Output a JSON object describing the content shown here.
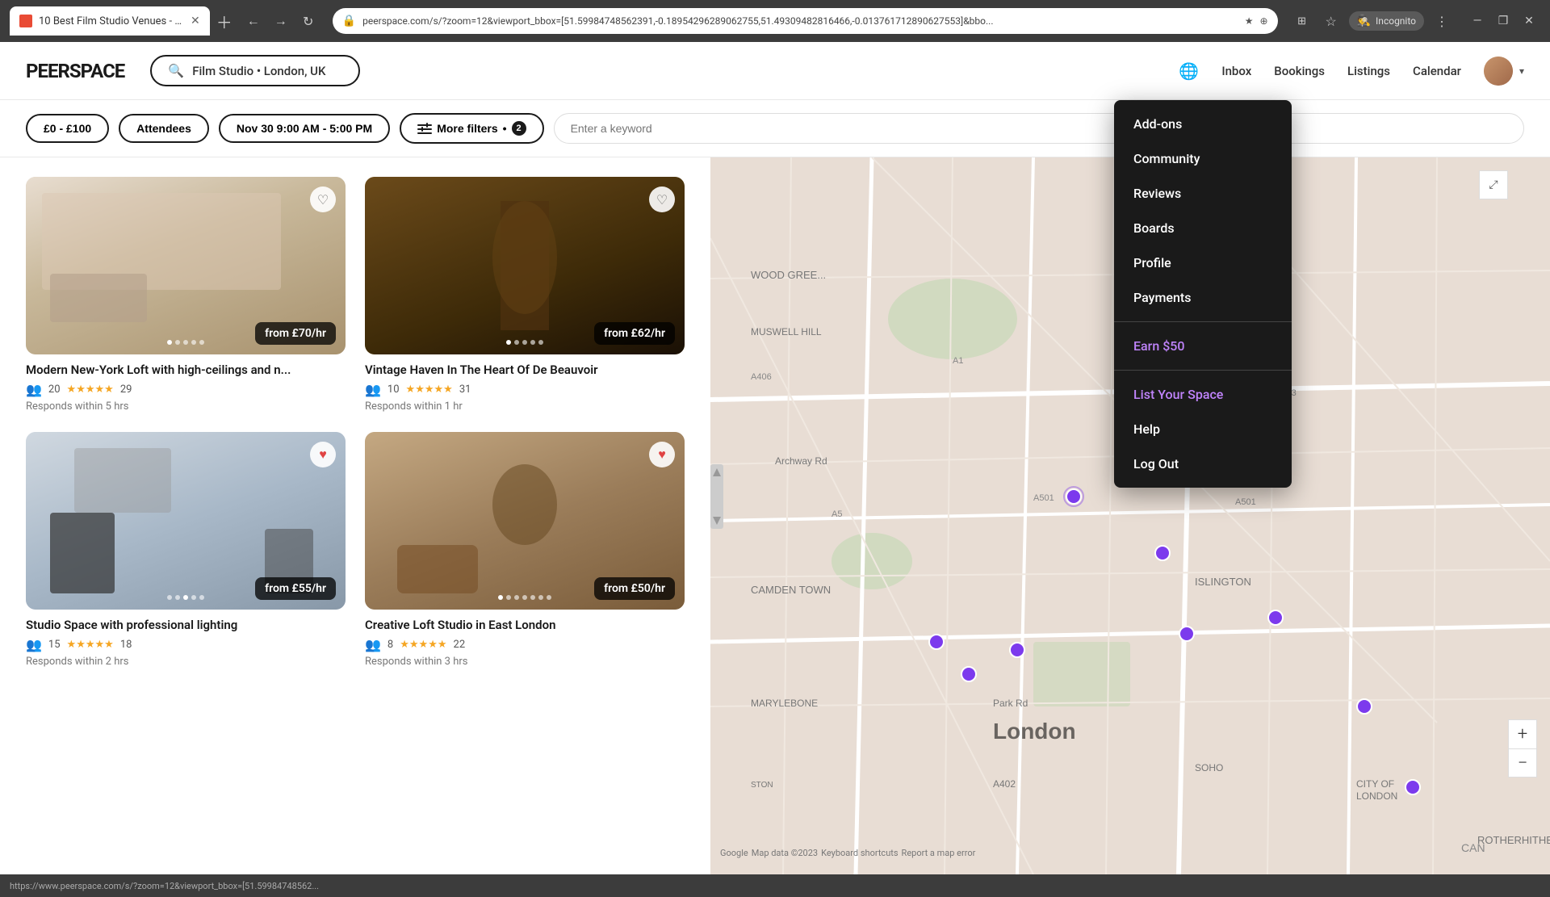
{
  "browser": {
    "tab_title": "10 Best Film Studio Venues - Lo...",
    "url": "peerspace.com/s/?zoom=12&viewport_bbox=[51.59984748562391,-0.18954296289062755,51.49309482816466,-0.013761712890627553]&bbo...",
    "status_url": "https://www.peerspace.com/s/?zoom=12&viewport_bbox=[51.59984748562...",
    "incognito_label": "Incognito"
  },
  "header": {
    "logo": "PEERSPACE",
    "search_text": "Film Studio • London, UK",
    "nav": {
      "inbox": "Inbox",
      "bookings": "Bookings",
      "listings": "Listings",
      "calendar": "Calendar"
    }
  },
  "filters": {
    "price": "£0 - £100",
    "attendees": "Attendees",
    "datetime": "Nov 30 9:00 AM - 5:00 PM",
    "more_filters": "More filters",
    "filter_count": "2",
    "keyword_placeholder": "Enter a keyword"
  },
  "listings": [
    {
      "title": "Modern New-York Loft with high-ceilings and n...",
      "price": "from £70/hr",
      "attendees": 20,
      "stars": "★★★★★",
      "reviews": 29,
      "response": "Responds within 5 hrs",
      "img_class": "img-1",
      "dots": 5,
      "active_dot": 0
    },
    {
      "title": "Vintage Haven In The Heart Of De Beauvoir",
      "price": "from £62/hr",
      "attendees": 10,
      "stars": "★★★★★",
      "reviews": 31,
      "response": "Responds within 1 hr",
      "img_class": "img-2",
      "dots": 5,
      "active_dot": 0
    },
    {
      "title": "Studio Space with professional lighting",
      "price": "from £55/hr",
      "attendees": 15,
      "stars": "★★★★★",
      "reviews": 18,
      "response": "Responds within 2 hrs",
      "img_class": "img-3",
      "dots": 5,
      "active_dot": 0
    },
    {
      "title": "Creative Loft Studio in East London",
      "price": "from £50/hr",
      "attendees": 8,
      "stars": "★★★★★",
      "reviews": 22,
      "response": "Responds within 3 hrs",
      "img_class": "img-4",
      "dots": 5,
      "active_dot": 0
    }
  ],
  "dropdown": {
    "items": [
      {
        "label": "Add-ons",
        "type": "normal"
      },
      {
        "label": "Community",
        "type": "normal"
      },
      {
        "label": "Reviews",
        "type": "normal"
      },
      {
        "label": "Boards",
        "type": "normal"
      },
      {
        "label": "Profile",
        "type": "normal"
      },
      {
        "label": "Payments",
        "type": "normal"
      },
      {
        "label": "Earn $50",
        "type": "purple"
      },
      {
        "label": "List Your Space",
        "type": "purple"
      },
      {
        "label": "Help",
        "type": "normal"
      },
      {
        "label": "Log Out",
        "type": "normal"
      }
    ]
  },
  "map": {
    "london_label": "London",
    "can_label": "CAN",
    "zoom_in": "+",
    "zoom_out": "−",
    "footer": "Google  Map data ©2023  Keyboard shortcuts  Report a map error"
  }
}
